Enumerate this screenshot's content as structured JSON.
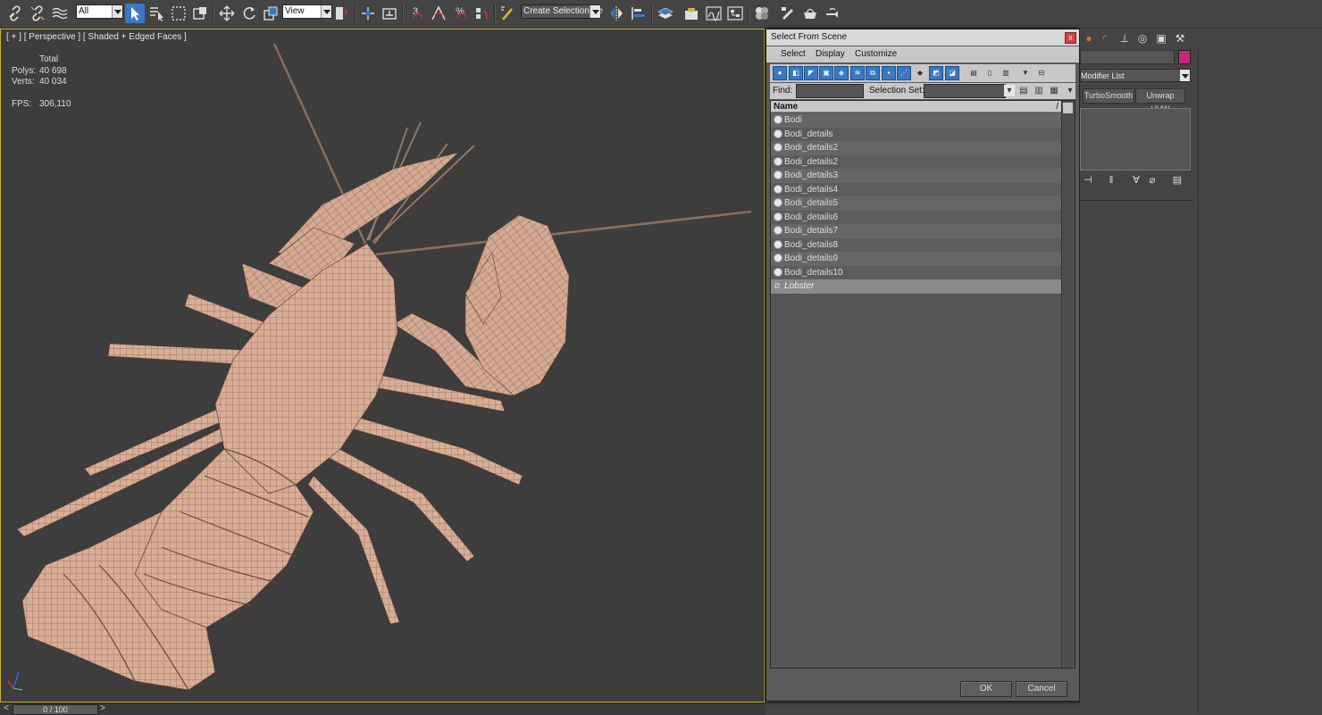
{
  "toolbar": {
    "filter_value": "All",
    "ref_coord_value": "View",
    "selection_set_value": "Create Selection Se",
    "snap_label": "3",
    "percent_label": "%"
  },
  "viewport": {
    "label": "[ + ] [ Perspective ] [ Shaded + Edged Faces ]",
    "stats_header": "Total",
    "polys_label": "Polys:",
    "polys_value": "40 698",
    "verts_label": "Verts:",
    "verts_value": "40 034",
    "fps_label": "FPS:",
    "fps_value": "306,110",
    "axis_z": "z",
    "axis_x": "x",
    "axis_y": "y"
  },
  "timeline": {
    "prev": "<",
    "frame": "0 / 100",
    "next": ">"
  },
  "dialog": {
    "title": "Select From Scene",
    "close": "x",
    "menu": [
      "Select",
      "Display",
      "Customize"
    ],
    "find_label": "Find:",
    "find_value": "",
    "selection_set_label": "Selection Set:",
    "selection_set_value": "",
    "column_name": "Name",
    "sort_indicator": "/",
    "items": [
      "Bodi",
      "Bodi_details",
      "Bodi_details2",
      "Bodi_details2",
      "Bodi_details3",
      "Bodi_details4",
      "Bodi_details5",
      "Bodi_details6",
      "Bodi_details7",
      "Bodi_details8",
      "Bodi_details9",
      "Bodi_details10"
    ],
    "group_item": "Lobster",
    "ok_label": "OK",
    "cancel_label": "Cancel"
  },
  "command_panel": {
    "modifier_list": "Modifier List",
    "turbosmooth": "TurboSmooth",
    "unwrap": "Unwrap UVW",
    "object_color": "#c8257e"
  }
}
